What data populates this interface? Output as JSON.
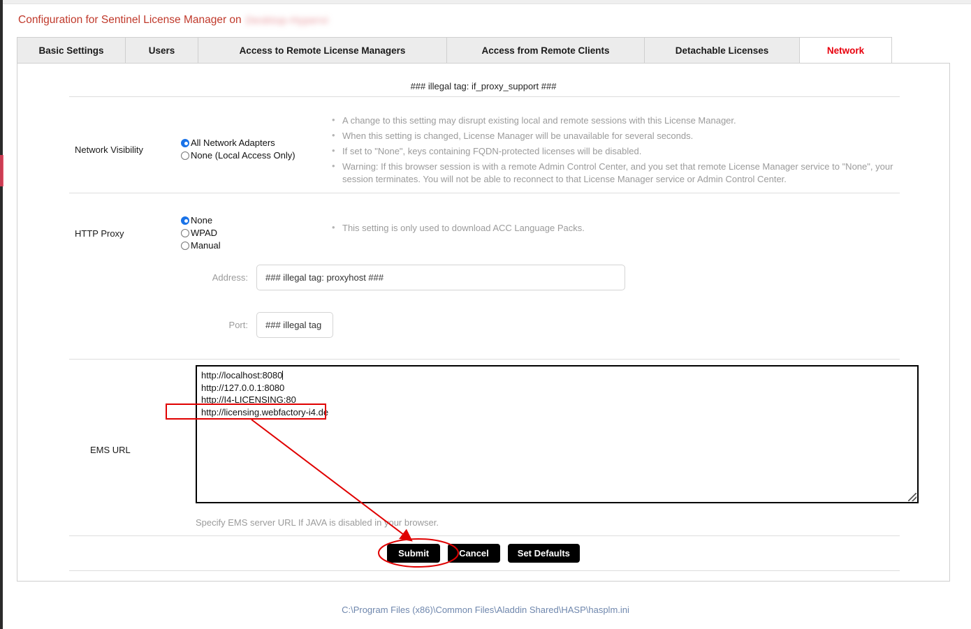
{
  "title": {
    "text": "Configuration for Sentinel License Manager on",
    "host_redacted": "Desktop-Hypervi",
    "color": "#c0392b"
  },
  "tabs": [
    {
      "label": "Basic Settings",
      "active": false
    },
    {
      "label": "Users",
      "active": false
    },
    {
      "label": "Access to Remote License Managers",
      "active": false
    },
    {
      "label": "Access from Remote Clients",
      "active": false
    },
    {
      "label": "Detachable Licenses",
      "active": false
    },
    {
      "label": "Network",
      "active": true
    }
  ],
  "panel": {
    "header_note": "### illegal tag: if_proxy_support ###",
    "network_visibility": {
      "label": "Network Visibility",
      "options": [
        {
          "label": "All Network Adapters",
          "checked": true
        },
        {
          "label": "None (Local Access Only)",
          "checked": false
        }
      ],
      "notes": [
        "A change to this setting may disrupt existing local and remote sessions with this License Manager.",
        "When this setting is changed, License Manager will be unavailable for several seconds.",
        "If set to \"None\", keys containing FQDN-protected licenses will be disabled.",
        "Warning: If this browser session is with a remote Admin Control Center, and you set that remote License Manager service to \"None\", your session terminates. You will not be able to reconnect to that License Manager service or Admin Control Center."
      ]
    },
    "http_proxy": {
      "label": "HTTP Proxy",
      "options": [
        {
          "label": "None",
          "checked": true
        },
        {
          "label": "WPAD",
          "checked": false
        },
        {
          "label": "Manual",
          "checked": false
        }
      ],
      "notes": [
        "This setting is only used to download ACC Language Packs."
      ],
      "address": {
        "label": "Address:",
        "value": "### illegal tag: proxyhost ###"
      },
      "port": {
        "label": "Port:",
        "value": "### illegal tag"
      }
    },
    "ems_url": {
      "label": "EMS URL",
      "lines": [
        "http://localhost:8080",
        "http://127.0.0.1:8080",
        "http://I4-LICENSING:80",
        "http://licensing.webfactory-i4.de"
      ],
      "help": "Specify EMS server URL If JAVA is disabled in your browser."
    },
    "buttons": [
      {
        "label": "Submit"
      },
      {
        "label": "Cancel"
      },
      {
        "label": "Set Defaults"
      }
    ]
  },
  "footer": {
    "path": "C:\\Program Files (x86)\\Common Files\\Aladdin Shared\\HASP\\hasplm.ini"
  },
  "annotations": {
    "color": "#e00000",
    "highlight_target": "http://licensing.webfactory-i4.de",
    "circle_target": "Submit"
  }
}
